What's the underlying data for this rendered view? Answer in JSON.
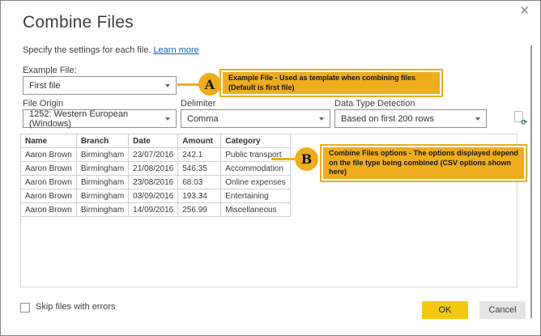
{
  "window": {
    "title": "Combine Files",
    "close_glyph": "✕"
  },
  "header": {
    "subtitle": "Specify the settings for each file.",
    "learn_more_label": "Learn more"
  },
  "fields": {
    "example_file": {
      "label": "Example File:",
      "value": "First file"
    },
    "file_origin": {
      "label": "File Origin",
      "value": "1252: Western European (Windows)"
    },
    "delimiter": {
      "label": "Delimiter",
      "value": "Comma"
    },
    "data_type_detection": {
      "label": "Data Type Detection",
      "value": "Based on first 200 rows"
    }
  },
  "icons": {
    "dropdown_arrow": "chevron-down",
    "file_refresh": "document-with-refresh-arrow",
    "refresh_glyph": "⟳",
    "close": "close-x"
  },
  "preview": {
    "columns": [
      "Name",
      "Branch",
      "Date",
      "Amount",
      "Category"
    ],
    "rows": [
      [
        "Aaron Brown",
        "Birmingham",
        "23/07/2016",
        "242.1",
        "Public transport"
      ],
      [
        "Aaron Brown",
        "Birmingham",
        "21/08/2016",
        "546.35",
        "Accommodation"
      ],
      [
        "Aaron Brown",
        "Birmingham",
        "23/08/2016",
        "68.03",
        "Online expenses"
      ],
      [
        "Aaron Brown",
        "Birmingham",
        "03/09/2016",
        "193.34",
        "Entertaining"
      ],
      [
        "Aaron Brown",
        "Birmingham",
        "14/09/2016",
        "256.99",
        "Miscellaneous"
      ]
    ]
  },
  "callouts": {
    "a": {
      "letter": "A",
      "line1": "Example File - Used as template when combining files",
      "line2": "(Default is first file)"
    },
    "b": {
      "letter": "B",
      "text": "Combine Files options - The options displayed depend on the file type being combined (CSV options shown here)"
    }
  },
  "footer": {
    "skip_files_label": "Skip files with errors",
    "ok_label": "OK",
    "cancel_label": "Cancel"
  },
  "colors": {
    "callout_gold": "#EDAD1F",
    "ok_yellow": "#F2C811",
    "link_blue": "#0563C1"
  }
}
